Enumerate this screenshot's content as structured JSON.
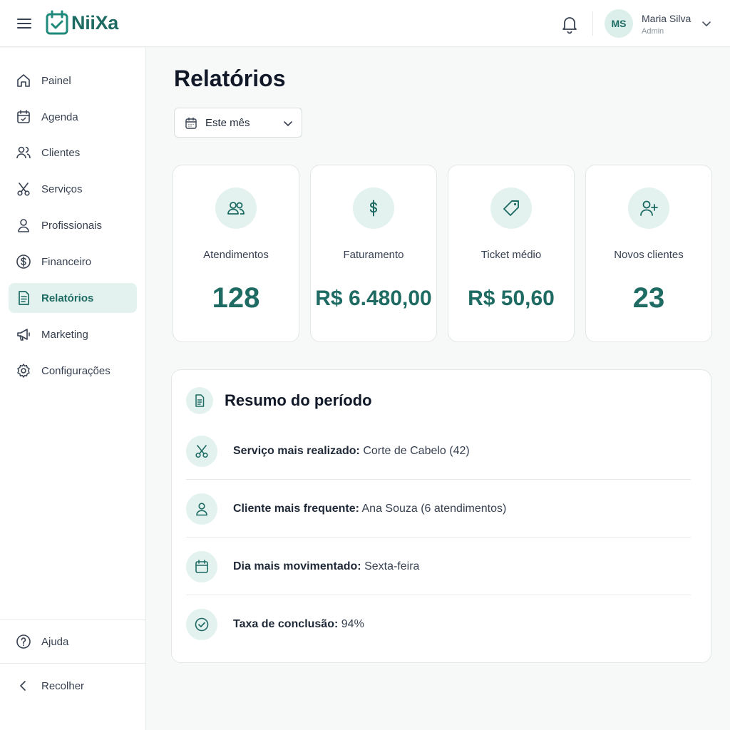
{
  "brand": {
    "name": "NiiXa",
    "color": "#1e6b63"
  },
  "user": {
    "initials": "MS",
    "name": "Maria Silva",
    "role": "Admin"
  },
  "sidebar": {
    "items": [
      {
        "label": "Painel",
        "icon": "home-icon"
      },
      {
        "label": "Agenda",
        "icon": "calendar-icon"
      },
      {
        "label": "Clientes",
        "icon": "users-icon"
      },
      {
        "label": "Serviços",
        "icon": "scissors-icon"
      },
      {
        "label": "Profissionais",
        "icon": "user-icon"
      },
      {
        "label": "Financeiro",
        "icon": "dollar-circle-icon"
      },
      {
        "label": "Relatórios",
        "icon": "report-icon",
        "active": true
      },
      {
        "label": "Marketing",
        "icon": "megaphone-icon"
      },
      {
        "label": "Configurações",
        "icon": "gear-icon"
      }
    ],
    "help_label": "Ajuda",
    "collapse_label": "Recolher"
  },
  "main": {
    "title": "Relatórios",
    "period": {
      "selected": "Este mês"
    },
    "stats": [
      {
        "label": "Atendimentos",
        "value": "128",
        "icon": "users-icon"
      },
      {
        "label": "Faturamento",
        "value": "R$ 6.480,00",
        "icon": "dollar-icon"
      },
      {
        "label": "Ticket médio",
        "value": "R$ 50,60",
        "icon": "tag-icon"
      },
      {
        "label": "Novos clientes",
        "value": "23",
        "icon": "user-plus-icon"
      }
    ],
    "summary": {
      "title": "Resumo do período",
      "rows": [
        {
          "key": "Serviço mais realizado:",
          "value": "Corte de Cabelo (42)",
          "icon": "scissors-icon"
        },
        {
          "key": "Cliente mais frequente:",
          "value": "Ana Souza (6 atendimentos)",
          "icon": "user-icon"
        },
        {
          "key": "Dia mais movimentado:",
          "value": "Sexta-feira",
          "icon": "calendar-icon"
        },
        {
          "key": "Taxa de conclusão:",
          "value": "94%",
          "icon": "check-circle-icon"
        }
      ]
    }
  }
}
